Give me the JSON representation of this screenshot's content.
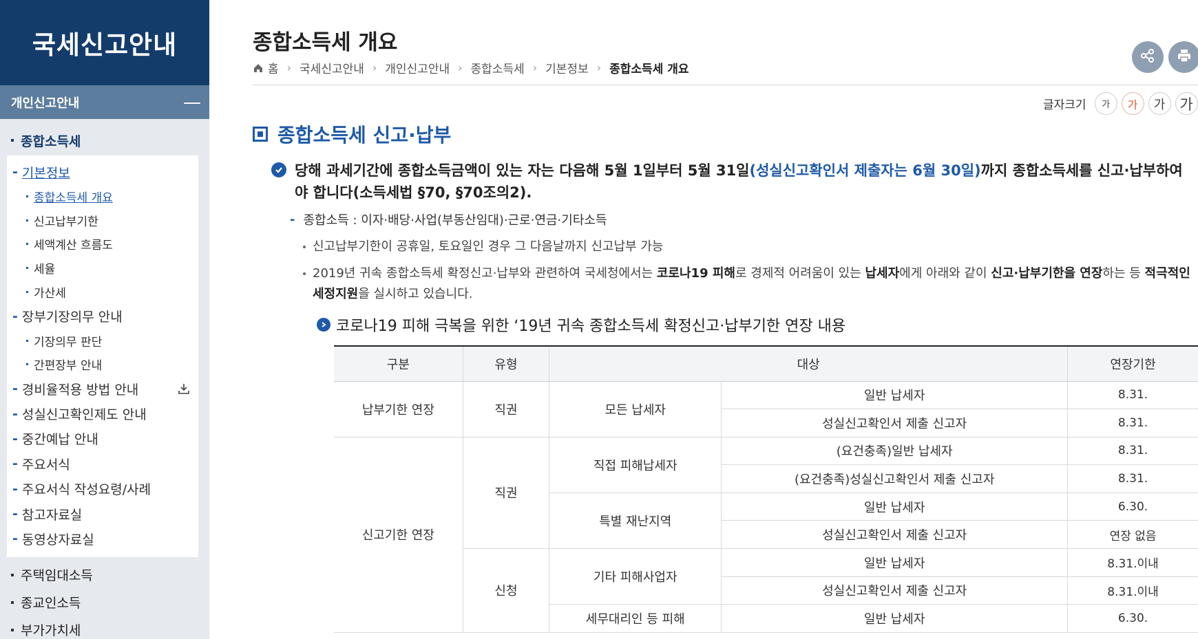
{
  "sidebar": {
    "title": "국세신고안내",
    "section": "개인신고안내",
    "section_toggle": "—",
    "top_items": [
      "종합소득세",
      "주택임대소득",
      "종교인소득",
      "부가가치세"
    ],
    "submenu": {
      "basic_info": "기본정보",
      "basic_children": [
        "종합소득세 개요",
        "신고납부기한",
        "세액계산 흐름도",
        "세율",
        "가산세"
      ],
      "ledger": "장부기장의무 안내",
      "ledger_children": [
        "기장의무 판단",
        "간편장부 안내"
      ],
      "others": [
        "경비율적용 방법 안내",
        "성실신고확인제도 안내",
        "중간예납 안내",
        "주요서식",
        "주요서식 작성요령/사례",
        "참고자료실",
        "동영상자료실"
      ]
    }
  },
  "header": {
    "title": "종합소득세 개요",
    "breadcrumb": [
      "홈",
      "국세신고안내",
      "개인신고안내",
      "종합소득세",
      "기본정보",
      "종합소득세 개요"
    ]
  },
  "font_size": {
    "label": "글자크기",
    "options": [
      "가",
      "가",
      "가",
      "가"
    ]
  },
  "content": {
    "section_heading": "종합소득세 신고·납부",
    "main_para": {
      "part1": "당해 과세기간에 종합소득금액이 있는 자는 다음해 5월 1일부터 5월 31일",
      "highlight": "(성실신고확인서 제출자는 6월 30일)",
      "part2": "까지 종합소득세를 신고·납부하여야 합니다(소득세법 §70, §70조의2)."
    },
    "sub_line": "종합소득 : 이자·배당·사업(부동산임대)·근로·연금·기타소득",
    "bullet1": "신고납부기한이 공휴일, 토요일인 경우 그 다음날까지 신고납부 가능",
    "bullet2": {
      "t1": "2019년 귀속 종합소득세 확정신고·납부와 관련하여 국세청에서는 ",
      "b1": "코로나19 피해",
      "t2": "로 경제적 어려움이 있는 ",
      "b2": "납세자",
      "t3": "에게 아래와 같이 ",
      "b3": "신고·납부기한을 연장",
      "t4": "하는 등 ",
      "b4": "적극적인 세정지원",
      "t5": "을 실시하고 있습니다."
    },
    "table_caption": "코로나19 피해 극복을 위한 ‘19년 귀속 종합소득세 확정신고·납부기한 연장 내용"
  },
  "table": {
    "headers": [
      "구분",
      "유형",
      "대상",
      "연장기한"
    ],
    "groups": [
      "납부기한 연장",
      "신고기한 연장"
    ],
    "types": [
      "직권",
      "직권",
      "신청"
    ],
    "targets": [
      "모든 납세자",
      "직접 피해납세자",
      "특별 재난지역",
      "기타 피해사업자",
      "세무대리인 등 피해"
    ],
    "subjects": [
      "일반 납세자",
      "성실신고확인서 제출 신고자",
      "(요건충족)일반 납세자",
      "(요건충족)성실신고확인서 제출 신고자",
      "일반 납세자",
      "성실신고확인서 제출 신고자",
      "일반 납세자",
      "성실신고확인서 제출 신고자",
      "일반 납세자"
    ],
    "deadlines": [
      "8.31.",
      "8.31.",
      "8.31.",
      "8.31.",
      "6.30.",
      "연장 없음",
      "8.31.이내",
      "8.31.이내",
      "6.30."
    ]
  }
}
